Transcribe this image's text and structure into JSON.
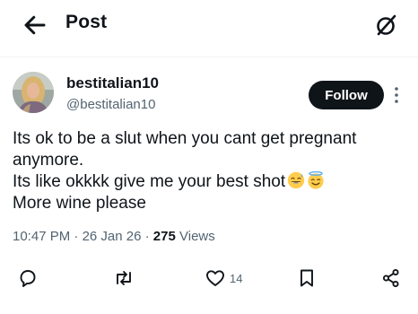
{
  "header": {
    "title": "Post"
  },
  "author": {
    "display_name": "bestitalian10",
    "handle": "@bestitalian10",
    "follow_label": "Follow"
  },
  "post": {
    "lines": [
      "Its ok to be a slut when you cant get pregnant",
      "anymore.",
      "Its like okkkk give me your best shot",
      "More wine please"
    ],
    "emojis": [
      "grinning-sweat-emoji",
      "smiling-halo-emoji"
    ]
  },
  "meta": {
    "time": "10:47 PM",
    "date": "26 Jan 26",
    "views_count": "275",
    "views_label": "Views"
  },
  "actions": {
    "like_count": "14"
  },
  "icons": [
    "back-arrow-icon",
    "grok-icon",
    "more-icon",
    "reply-icon",
    "repost-icon",
    "like-icon",
    "bookmark-icon",
    "share-icon"
  ],
  "colors": {
    "text": "#0f1419",
    "secondary": "#536471",
    "follow_bg": "#0f1419",
    "divider": "#eff3f4"
  }
}
